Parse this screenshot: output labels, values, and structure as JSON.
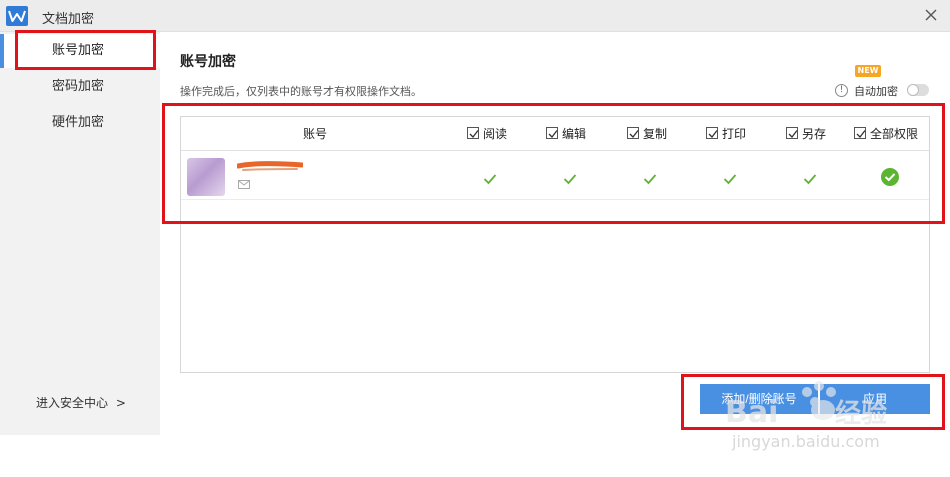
{
  "window": {
    "title": "文档加密"
  },
  "sidebar": {
    "items": [
      {
        "label": "账号加密",
        "active": true
      },
      {
        "label": "密码加密",
        "active": false
      },
      {
        "label": "硬件加密",
        "active": false
      }
    ],
    "security_center": "进入安全中心",
    "security_center_arrow": ">"
  },
  "main": {
    "heading": "账号加密",
    "description": "操作完成后，仅列表中的账号才有权限操作文档。",
    "new_badge": "NEW",
    "info_icon": "!",
    "auto_encrypt_label": "自动加密",
    "auto_encrypt_on": false
  },
  "table": {
    "account_header": "账号",
    "permissions": [
      "阅读",
      "编辑",
      "复制",
      "打印",
      "另存",
      "全部权限"
    ],
    "rows": [
      {
        "account": "",
        "permissions": [
          true,
          true,
          true,
          true,
          true,
          true
        ]
      }
    ]
  },
  "buttons": {
    "add_remove": "添加/删除账号",
    "apply": "应用"
  },
  "watermark": {
    "brand": "Baidu经验",
    "url": "jingyan.baidu.com"
  },
  "colors": {
    "accent": "#4a90e2",
    "check_green": "#5cb531",
    "highlight_red": "#e0131a",
    "new_badge": "#f5a623"
  }
}
